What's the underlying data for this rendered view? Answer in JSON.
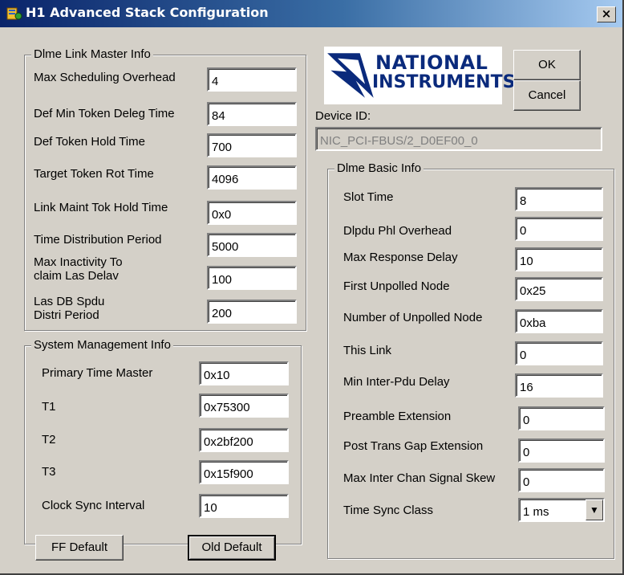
{
  "window": {
    "title": "H1 Advanced Stack Configuration",
    "close_glyph": "×"
  },
  "dlme_link_master": {
    "legend": "Dlme Link Master Info",
    "rows": [
      {
        "label": "Max Scheduling Overhead",
        "value": "4"
      },
      {
        "label": "Def Min Token Deleg Time",
        "value": "84"
      },
      {
        "label": "Def Token Hold Time",
        "value": "700"
      },
      {
        "label": "Target Token Rot Time",
        "value": "4096"
      },
      {
        "label": "Link Maint Tok Hold Time",
        "value": "0x0"
      },
      {
        "label": "Time Distribution Period",
        "value": "5000"
      },
      {
        "label_line1": "Max Inactivity To",
        "label_line2": "claim Las Delav",
        "value": "100"
      },
      {
        "label_line1": "Las DB Spdu",
        "label_line2": "Distri Period",
        "value": "200"
      }
    ]
  },
  "system_management": {
    "legend": "System Management Info",
    "rows": [
      {
        "label": "Primary Time Master",
        "value": "0x10"
      },
      {
        "label": "T1",
        "value": "0x75300"
      },
      {
        "label": "T2",
        "value": "0x2bf200"
      },
      {
        "label": "T3",
        "value": "0x15f900"
      },
      {
        "label": "Clock Sync Interval",
        "value": "10"
      }
    ]
  },
  "logo": {
    "line1": "NATIONAL",
    "line2": "INSTRUMENTS"
  },
  "device": {
    "label": "Device ID:",
    "value": "NIC_PCI-FBUS/2_D0EF00_0"
  },
  "dlme_basic": {
    "legend": "Dlme Basic Info",
    "rows": [
      {
        "label": "Slot Time",
        "value": "8"
      },
      {
        "label": "Dlpdu Phl Overhead",
        "value": "0"
      },
      {
        "label": "Max Response Delay",
        "value": "10"
      },
      {
        "label": "First Unpolled Node",
        "value": "0x25"
      },
      {
        "label": "Number of Unpolled Node",
        "value": "0xba"
      },
      {
        "label": "This Link",
        "value": "0"
      },
      {
        "label": "Min Inter-Pdu Delay",
        "value": "16"
      },
      {
        "label": "Preamble Extension",
        "value": "0"
      },
      {
        "label": "Post Trans Gap Extension",
        "value": "0"
      },
      {
        "label": "Max Inter Chan Signal Skew",
        "value": "0"
      },
      {
        "label": "Time Sync Class",
        "value": "1 ms",
        "arrow": "▼"
      }
    ]
  },
  "buttons": {
    "ok": "OK",
    "cancel": "Cancel",
    "ff_default": "FF Default",
    "old_default": "Old Default"
  },
  "colors": {
    "titlebar_start": "#0a246a",
    "titlebar_end": "#a6caf0",
    "face": "#d4d0c8",
    "logo_blue": "#0a2a7c"
  }
}
